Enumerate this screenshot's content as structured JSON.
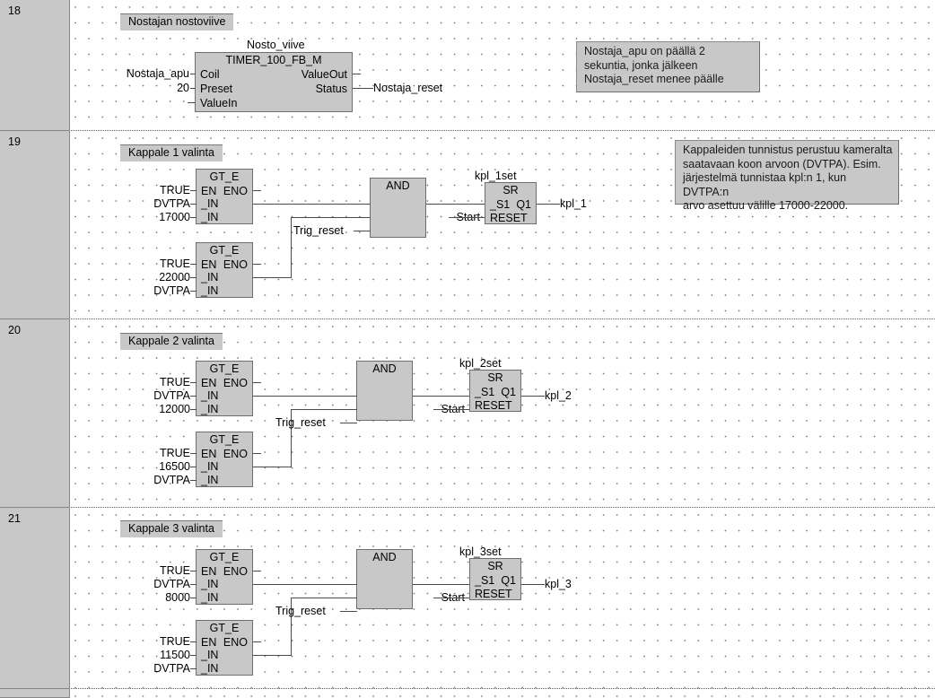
{
  "editor": {
    "type": "fbd-ladder-editor",
    "language": "Function Block Diagram"
  },
  "rungs": [
    {
      "number": "18",
      "title": "Nostajan nostoviive",
      "comment": "Nostaja_apu on päällä 2\nsekuntia, jonka jälkeen\nNostaja_reset menee päälle",
      "blocks": [
        {
          "instance": "Nosto_viive",
          "type": "TIMER_100_FB_M",
          "inputs": [
            "Coil",
            "Preset",
            "ValueIn"
          ],
          "outputs": [
            "ValueOut",
            "Status"
          ]
        }
      ],
      "operands": {
        "coil_in": "Nostaja_apu",
        "preset_in": "20",
        "status_out": "Nostaja_reset"
      }
    },
    {
      "number": "19",
      "title": "Kappale 1 valinta",
      "comment": "Kappaleiden tunnistus perustuu kameralta\nsaatavaan koon arvoon (DVTPA). Esim.\njärjestelmä tunnistaa kpl:n 1, kun DVTPA:n\narvo asettuu välille 17000-22000.",
      "cmp1": {
        "type": "GT_E",
        "en_label": "EN",
        "eno_label": "ENO",
        "in_label": "_IN",
        "en_operand": "TRUE",
        "in1_operand": "DVTPA",
        "in2_operand": "17000"
      },
      "cmp2": {
        "type": "GT_E",
        "en_label": "EN",
        "eno_label": "ENO",
        "in_label": "_IN",
        "en_operand": "TRUE",
        "in1_operand": "22000",
        "in2_operand": "DVTPA"
      },
      "and": {
        "type": "AND",
        "third_in_operand": "Trig_reset"
      },
      "sr": {
        "instance": "kpl_1set",
        "type": "SR",
        "s1_label": "_S1",
        "q1_label": "Q1",
        "reset_label": "RESET",
        "reset_operand": "Start",
        "q1_operand": "kpl_1"
      }
    },
    {
      "number": "20",
      "title": "Kappale 2 valinta",
      "cmp1": {
        "type": "GT_E",
        "en_label": "EN",
        "eno_label": "ENO",
        "in_label": "_IN",
        "en_operand": "TRUE",
        "in1_operand": "DVTPA",
        "in2_operand": "12000"
      },
      "cmp2": {
        "type": "GT_E",
        "en_label": "EN",
        "eno_label": "ENO",
        "in_label": "_IN",
        "en_operand": "TRUE",
        "in1_operand": "16500",
        "in2_operand": "DVTPA"
      },
      "and": {
        "type": "AND",
        "third_in_operand": "Trig_reset"
      },
      "sr": {
        "instance": "kpl_2set",
        "type": "SR",
        "s1_label": "_S1",
        "q1_label": "Q1",
        "reset_label": "RESET",
        "reset_operand": "Start",
        "q1_operand": "kpl_2"
      }
    },
    {
      "number": "21",
      "title": "Kappale 3 valinta",
      "cmp1": {
        "type": "GT_E",
        "en_label": "EN",
        "eno_label": "ENO",
        "in_label": "_IN",
        "en_operand": "TRUE",
        "in1_operand": "DVTPA",
        "in2_operand": "8000"
      },
      "cmp2": {
        "type": "GT_E",
        "en_label": "EN",
        "eno_label": "ENO",
        "in_label": "_IN",
        "en_operand": "TRUE",
        "in1_operand": "11500",
        "in2_operand": "DVTPA"
      },
      "and": {
        "type": "AND",
        "third_in_operand": "Trig_reset"
      },
      "sr": {
        "instance": "kpl_3set",
        "type": "SR",
        "s1_label": "_S1",
        "q1_label": "Q1",
        "reset_label": "RESET",
        "reset_operand": "Start",
        "q1_operand": "kpl_3"
      }
    },
    {
      "number": "",
      "title": "",
      "partial": true
    }
  ],
  "colors": {
    "block_fill": "#c8c8c8",
    "block_border": "#6e6e6e",
    "gutter_fill": "#c8c8c8",
    "wire": "#4a4a4a",
    "grid_dot": "#7d7d7d",
    "canvas": "#ffffff"
  }
}
